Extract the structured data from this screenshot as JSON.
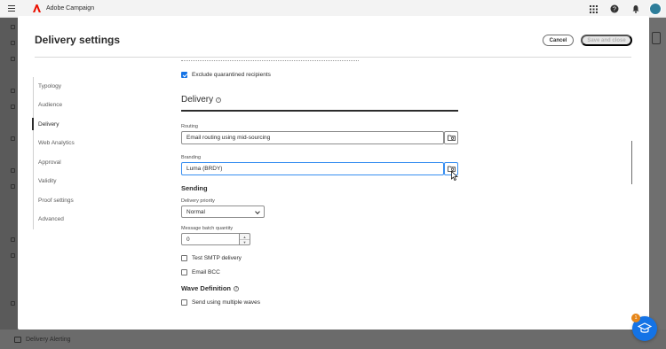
{
  "app": {
    "name": "Adobe Campaign"
  },
  "dialog": {
    "title": "Delivery settings",
    "cancel_label": "Cancel",
    "save_label": "Save and close"
  },
  "nav": {
    "items": [
      {
        "label": "Typology"
      },
      {
        "label": "Audience"
      },
      {
        "label": "Delivery",
        "active": true
      },
      {
        "label": "Web Analytics"
      },
      {
        "label": "Approval"
      },
      {
        "label": "Validity"
      },
      {
        "label": "Proof settings"
      },
      {
        "label": "Advanced"
      }
    ]
  },
  "content": {
    "exclude_quarantined": {
      "label": "Exclude quarantined recipients",
      "checked": true
    },
    "delivery_section": {
      "title": "Delivery"
    },
    "routing": {
      "label": "Routing",
      "value": "Email routing using mid-sourcing"
    },
    "branding": {
      "label": "Branding",
      "value": "Luma (BRDY)"
    },
    "sending": {
      "title": "Sending",
      "priority": {
        "label": "Delivery priority",
        "value": "Normal"
      },
      "batch": {
        "label": "Message batch quantity",
        "value": "0"
      },
      "test_smtp": {
        "label": "Test SMTP delivery",
        "checked": false
      },
      "email_bcc": {
        "label": "Email BCC",
        "checked": false
      }
    },
    "wave": {
      "title": "Wave Definition",
      "multiple_waves": {
        "label": "Send using multiple waves",
        "checked": false
      }
    }
  },
  "background": {
    "bottom_item": "Delivery Alerting"
  },
  "help_badge_count": "1",
  "colors": {
    "accent": "#1473e6",
    "badge": "#e68619",
    "brand_red": "#eb1000"
  }
}
